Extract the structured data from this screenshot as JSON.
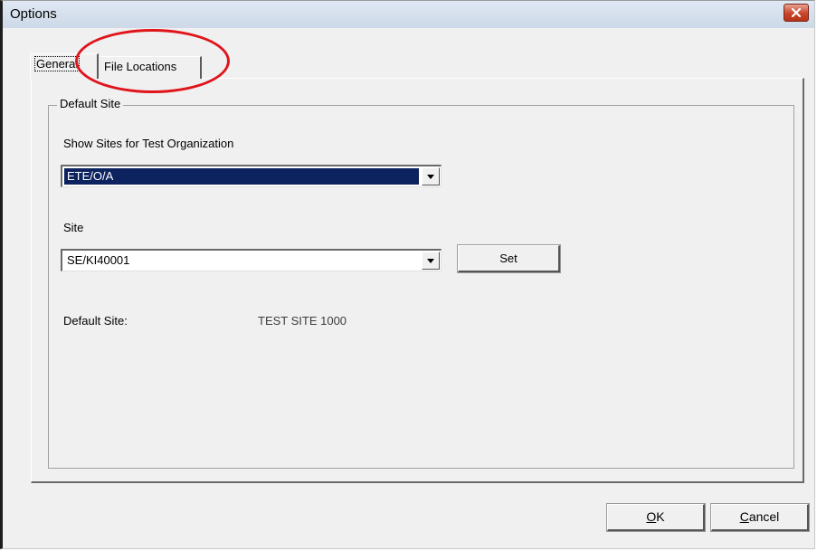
{
  "window": {
    "title": "Options"
  },
  "tabs": [
    {
      "label": "General",
      "selected": true
    },
    {
      "label": "File Locations",
      "selected": false
    }
  ],
  "group": {
    "title": "Default Site",
    "org_label": "Show Sites for Test Organization",
    "org_value": "ETE/O/A",
    "site_label": "Site",
    "site_value": "SE/KI40001",
    "set_label": "Set",
    "default_site_label": "Default Site:",
    "default_site_value": "TEST SITE 1000"
  },
  "buttons": {
    "ok_access": "O",
    "ok_rest": "K",
    "cancel_access": "C",
    "cancel_rest": "ancel"
  },
  "colors": {
    "highlight": "#0d2360",
    "annotation": "#e0141b",
    "close_button": "#c9442a"
  },
  "icons": [
    "close-icon",
    "dropdown-arrow-icon"
  ]
}
